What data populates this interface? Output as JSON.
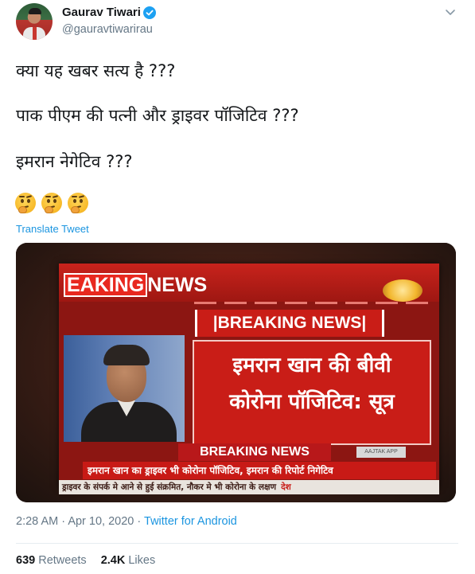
{
  "author": {
    "name": "Gaurav Tiwari",
    "handle": "@gauravtiwarirau",
    "verified": true
  },
  "tweet": {
    "lines": [
      "क्या यह खबर सत्य है ???",
      "पाक पीएम की पत्नी और ड्राइवर पॉजिटिव ???",
      "इमरान नेगेटिव ???"
    ],
    "emojis": [
      "thinking-face-icon",
      "thinking-face-icon",
      "thinking-face-icon"
    ],
    "translate_label": "Translate Tweet"
  },
  "media": {
    "brand": {
      "partial": "EAKING",
      "rest": "NEWS"
    },
    "banner": "|BREAKING NEWS|",
    "headline_line1": "इमरान खान की बीवी",
    "headline_line2": "कोरोना पॉजिटिव: सूत्र",
    "ticker_head": "BREAKING NEWS",
    "ticker_source": "AAJTAK APP",
    "ticker1": "इमरान खान का ड्राइवर भी कोरोना पॉजिटिव, इमरान की रिपोर्ट निगेटिव",
    "ticker2": "ड्राइवर के संपर्क मे आने से हुई संक्रमित, नौकर मे भी कोरोना के लक्षण",
    "ticker2_tag": "देश"
  },
  "meta": {
    "time": "2:28 AM",
    "date": "Apr 10, 2020",
    "separator": "·",
    "source": "Twitter for Android"
  },
  "stats": {
    "retweets_count": "639",
    "retweets_label": "Retweets",
    "likes_count": "2.4K",
    "likes_label": "Likes"
  },
  "colors": {
    "link": "#1b95e0",
    "secondary_text": "#657786",
    "verified_badge": "#1da1f2",
    "news_red": "#c91d17"
  }
}
